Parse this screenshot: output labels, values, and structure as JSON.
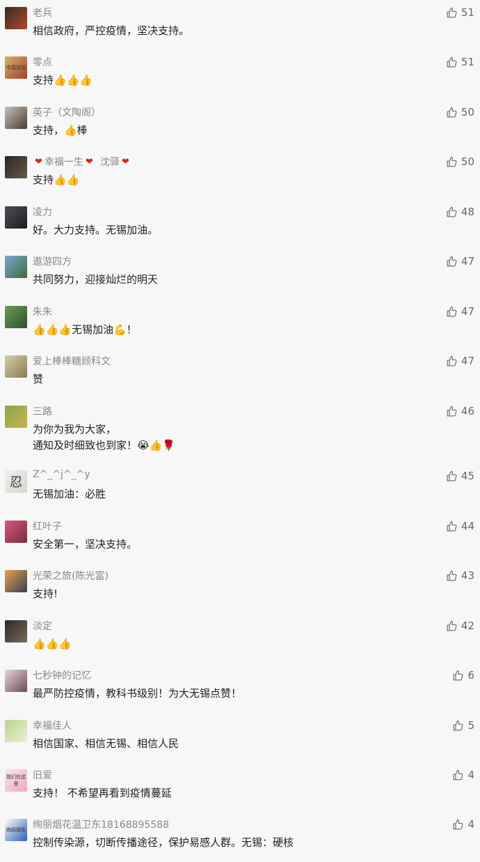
{
  "comments": [
    {
      "name": "老兵",
      "text": "相信政府，严控疫情，坚决支持。",
      "likes": "51",
      "avatar_colors": [
        "#3a2a22",
        "#b0472c"
      ]
    },
    {
      "name": "零点",
      "text": "支持👍👍👍",
      "likes": "51",
      "avatar_colors": [
        "#d8b26b",
        "#a0402a"
      ],
      "avatar_text": "中国加油"
    },
    {
      "name": "英子（文陶阁）",
      "text": "支持，👍棒",
      "likes": "50",
      "avatar_colors": [
        "#c9c3b9",
        "#4a3a33"
      ]
    },
    {
      "name_parts": [
        "幸福一生",
        "沈驿"
      ],
      "text": "支持👍👍",
      "likes": "50",
      "avatar_colors": [
        "#2b2520",
        "#6a5a4c"
      ]
    },
    {
      "name": "凌力",
      "text": "好。大力支持。无锡加油。",
      "likes": "48",
      "avatar_colors": [
        "#4b4f55",
        "#1c1c1e"
      ]
    },
    {
      "name": "遨游四方",
      "text": "共同努力，迎接灿烂的明天",
      "likes": "47",
      "avatar_colors": [
        "#7aa8d6",
        "#3b6a3a"
      ]
    },
    {
      "name": "朱朱",
      "text": "👍👍👍无锡加油💪！",
      "likes": "47",
      "avatar_colors": [
        "#6c9b5a",
        "#2f4f2a"
      ]
    },
    {
      "name": "爱上棒棒糖顾科文",
      "text": "赞",
      "likes": "47",
      "avatar_colors": [
        "#d6cfa8",
        "#8a7a52"
      ]
    },
    {
      "name": "三路",
      "text": "为你为我为大家，\n通知及时细致也到家！😭👍🌹",
      "likes": "46",
      "avatar_colors": [
        "#88a64c",
        "#c7b44e"
      ]
    },
    {
      "name": "Z^_^j^_^y",
      "text": "无锡加油：必胜",
      "likes": "45",
      "avatar_colors": [
        "#eeeeea",
        "#d8d6d0"
      ],
      "avatar_text": "忍"
    },
    {
      "name": "红叶子",
      "text": "安全第一，坚决支持。",
      "likes": "44",
      "avatar_colors": [
        "#d7567a",
        "#7a2e3e"
      ]
    },
    {
      "name": "光荣之旅(陈光富)",
      "text": "支持!",
      "likes": "43",
      "avatar_colors": [
        "#e7a156",
        "#3a3f4a"
      ]
    },
    {
      "name": "淡定",
      "text": "👍👍👍",
      "likes": "42",
      "avatar_colors": [
        "#2a2a2a",
        "#7a6a5a"
      ]
    },
    {
      "name": "七秒钟的记忆",
      "text": "最严防控疫情，教科书级别！为大无锡点赞！",
      "likes": "6",
      "avatar_colors": [
        "#e8d5dc",
        "#6a4a56"
      ]
    },
    {
      "name": "幸福佳人",
      "text": "相信国家、相信无锡、相信人民",
      "likes": "5",
      "avatar_colors": [
        "#b9d48a",
        "#e8f0d8"
      ]
    },
    {
      "name": "旧爱",
      "text": "支持！ 不希望再看到疫情蔓延",
      "likes": "4",
      "avatar_colors": [
        "#fbe6ee",
        "#f0a8c0"
      ],
      "avatar_text": "我们在这里"
    },
    {
      "name": "绚丽烟花温卫东18168895588",
      "text": "控制传染源，切断传播途径，保护易感人群。无锡：硬核",
      "likes": "4",
      "avatar_colors": [
        "#ffffff",
        "#2b5fb8"
      ],
      "avatar_text": "绚丽烟花"
    }
  ]
}
